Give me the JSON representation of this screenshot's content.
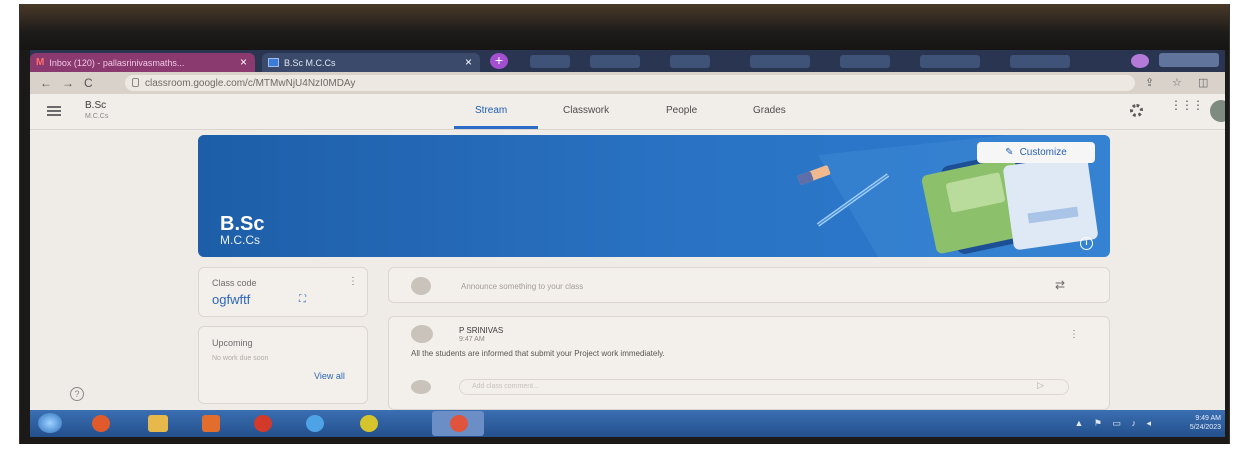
{
  "browser": {
    "tabs": [
      {
        "label": "Inbox (120) - pallasrinivasmaths..."
      },
      {
        "label": "B.Sc M.C.Cs"
      }
    ],
    "url": "classroom.google.com/c/MTMwNjU4NzI0MDAy"
  },
  "header": {
    "course_title": "B.Sc",
    "course_subtitle": "M.C.Cs",
    "nav_tabs": [
      "Stream",
      "Classwork",
      "People",
      "Grades"
    ]
  },
  "banner": {
    "title": "B.Sc",
    "subtitle": "M.C.Cs",
    "customize_label": "Customize"
  },
  "class_code": {
    "label": "Class code",
    "value": "ogfwftf"
  },
  "upcoming": {
    "label": "Upcoming",
    "empty_text": "No work due soon",
    "view_all": "View all"
  },
  "announce": {
    "placeholder": "Announce something to your class"
  },
  "post": {
    "author": "P SRINIVAS",
    "time": "9:47 AM",
    "body": "All the students are informed that submit your Project work immediately.",
    "comment_placeholder": "Add class comment..."
  },
  "taskbar": {
    "time": "9:49 AM",
    "date": "5/24/2023"
  },
  "colors": {
    "banner": "#2a73c4",
    "accent": "#2c6bc7",
    "taskbar": "#2f5f9e"
  }
}
